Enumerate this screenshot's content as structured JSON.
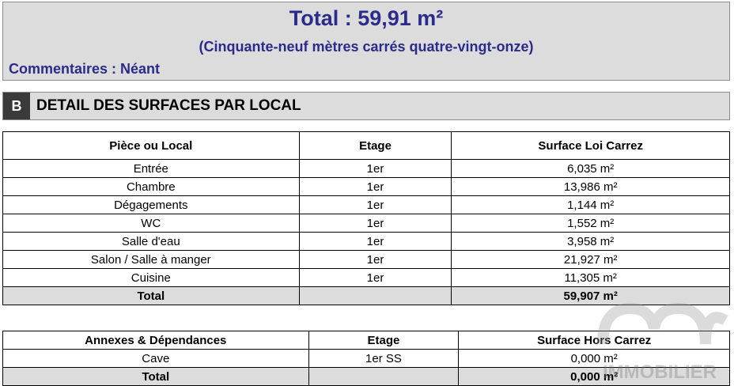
{
  "summary": {
    "total": "Total : 59,91 m²",
    "total_words": "(Cinquante-neuf mètres carrés quatre-vingt-onze)",
    "comments": "Commentaires : Néant"
  },
  "section": {
    "letter": "B",
    "title": "DETAIL DES SURFACES PAR LOCAL"
  },
  "rooms_table": {
    "headers": [
      "Pièce ou Local",
      "Etage",
      "Surface Loi Carrez"
    ],
    "rows": [
      [
        "Entrée",
        "1er",
        "6,035 m²"
      ],
      [
        "Chambre",
        "1er",
        "13,986 m²"
      ],
      [
        "Dégagements",
        "1er",
        "1,144 m²"
      ],
      [
        "WC",
        "1er",
        "1,552 m²"
      ],
      [
        "Salle d'eau",
        "1er",
        "3,958 m²"
      ],
      [
        "Salon / Salle à manger",
        "1er",
        "21,927 m²"
      ],
      [
        "Cuisine",
        "1er",
        "11,305 m²"
      ]
    ],
    "total_label": "Total",
    "total_value": "59,907 m²"
  },
  "annexes_table": {
    "headers": [
      "Annexes & Dépendances",
      "Etage",
      "Surface Hors Carrez"
    ],
    "rows": [
      [
        "Cave",
        "1er SS",
        "0,000 m²"
      ]
    ],
    "total_label": "Total",
    "total_value": "0,000 m²"
  },
  "watermark": {
    "text": "IMMOBILIER"
  }
}
